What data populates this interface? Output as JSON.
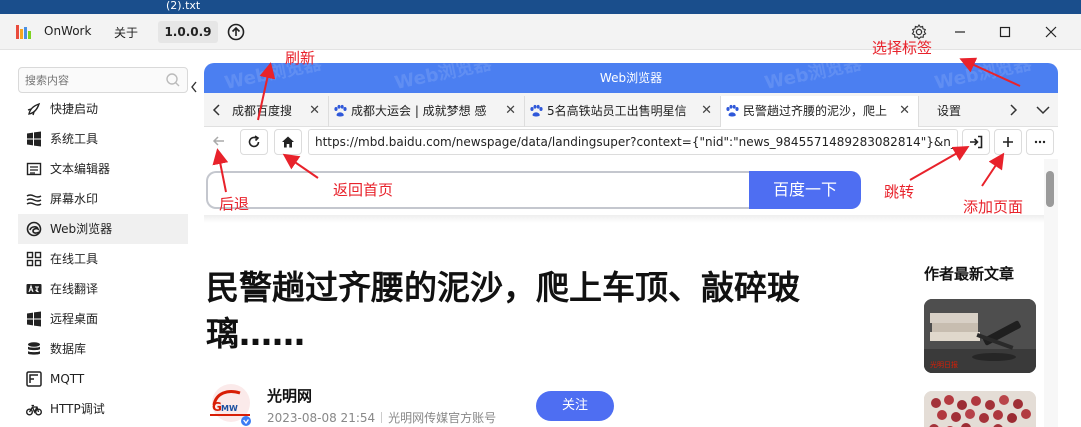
{
  "desktop": {
    "file_label": "(2).txt"
  },
  "titlebar": {
    "app_name": "OnWork",
    "about": "关于",
    "version": "1.0.0.9"
  },
  "sidebar": {
    "search_placeholder": "搜索内容",
    "items": [
      {
        "label": "快捷启动",
        "icon": "rocket-icon"
      },
      {
        "label": "系统工具",
        "icon": "windows-icon"
      },
      {
        "label": "文本编辑器",
        "icon": "text-editor-icon"
      },
      {
        "label": "屏幕水印",
        "icon": "watermark-icon"
      },
      {
        "label": "Web浏览器",
        "icon": "edge-browser-icon",
        "active": true
      },
      {
        "label": "在线工具",
        "icon": "grid-icon"
      },
      {
        "label": "在线翻译",
        "icon": "translate-icon"
      },
      {
        "label": "远程桌面",
        "icon": "windows-icon"
      },
      {
        "label": "数据库",
        "icon": "database-icon"
      },
      {
        "label": "MQTT",
        "icon": "mqtt-icon"
      },
      {
        "label": "HTTP调试",
        "icon": "bike-icon"
      }
    ]
  },
  "browser": {
    "title": "Web浏览器",
    "watermark": "Web浏览器",
    "tabs": [
      {
        "label": "成都百度搜"
      },
      {
        "label": "成都大运会 | 成就梦想 感"
      },
      {
        "label": "5名高铁站员工出售明星信"
      },
      {
        "label": "民警趟过齐腰的泥沙，爬上",
        "active": true
      },
      {
        "label": "设置"
      }
    ],
    "url": "https://mbd.baidu.com/newspage/data/landingsuper?context={\"nid\":\"news_9845571489283082814\"}&n_type=",
    "baidu_button": "百度一下",
    "headline": "民警趟过齐腰的泥沙，爬上车顶、敲碎玻璃……",
    "author": {
      "name": "光明网",
      "date": "2023-08-08 21:54",
      "account": "光明网传媒官方账号",
      "follow": "关注"
    },
    "side_title": "作者最新文章"
  },
  "annotations": {
    "refresh": "刷新",
    "select_tab": "选择标签",
    "back": "后退",
    "home": "返回首页",
    "jump": "跳转",
    "add_page": "添加页面"
  },
  "colors": {
    "accent": "#4b7ff1",
    "baidu_blue": "#4e6ef2",
    "annotation_red": "#e8222b"
  }
}
